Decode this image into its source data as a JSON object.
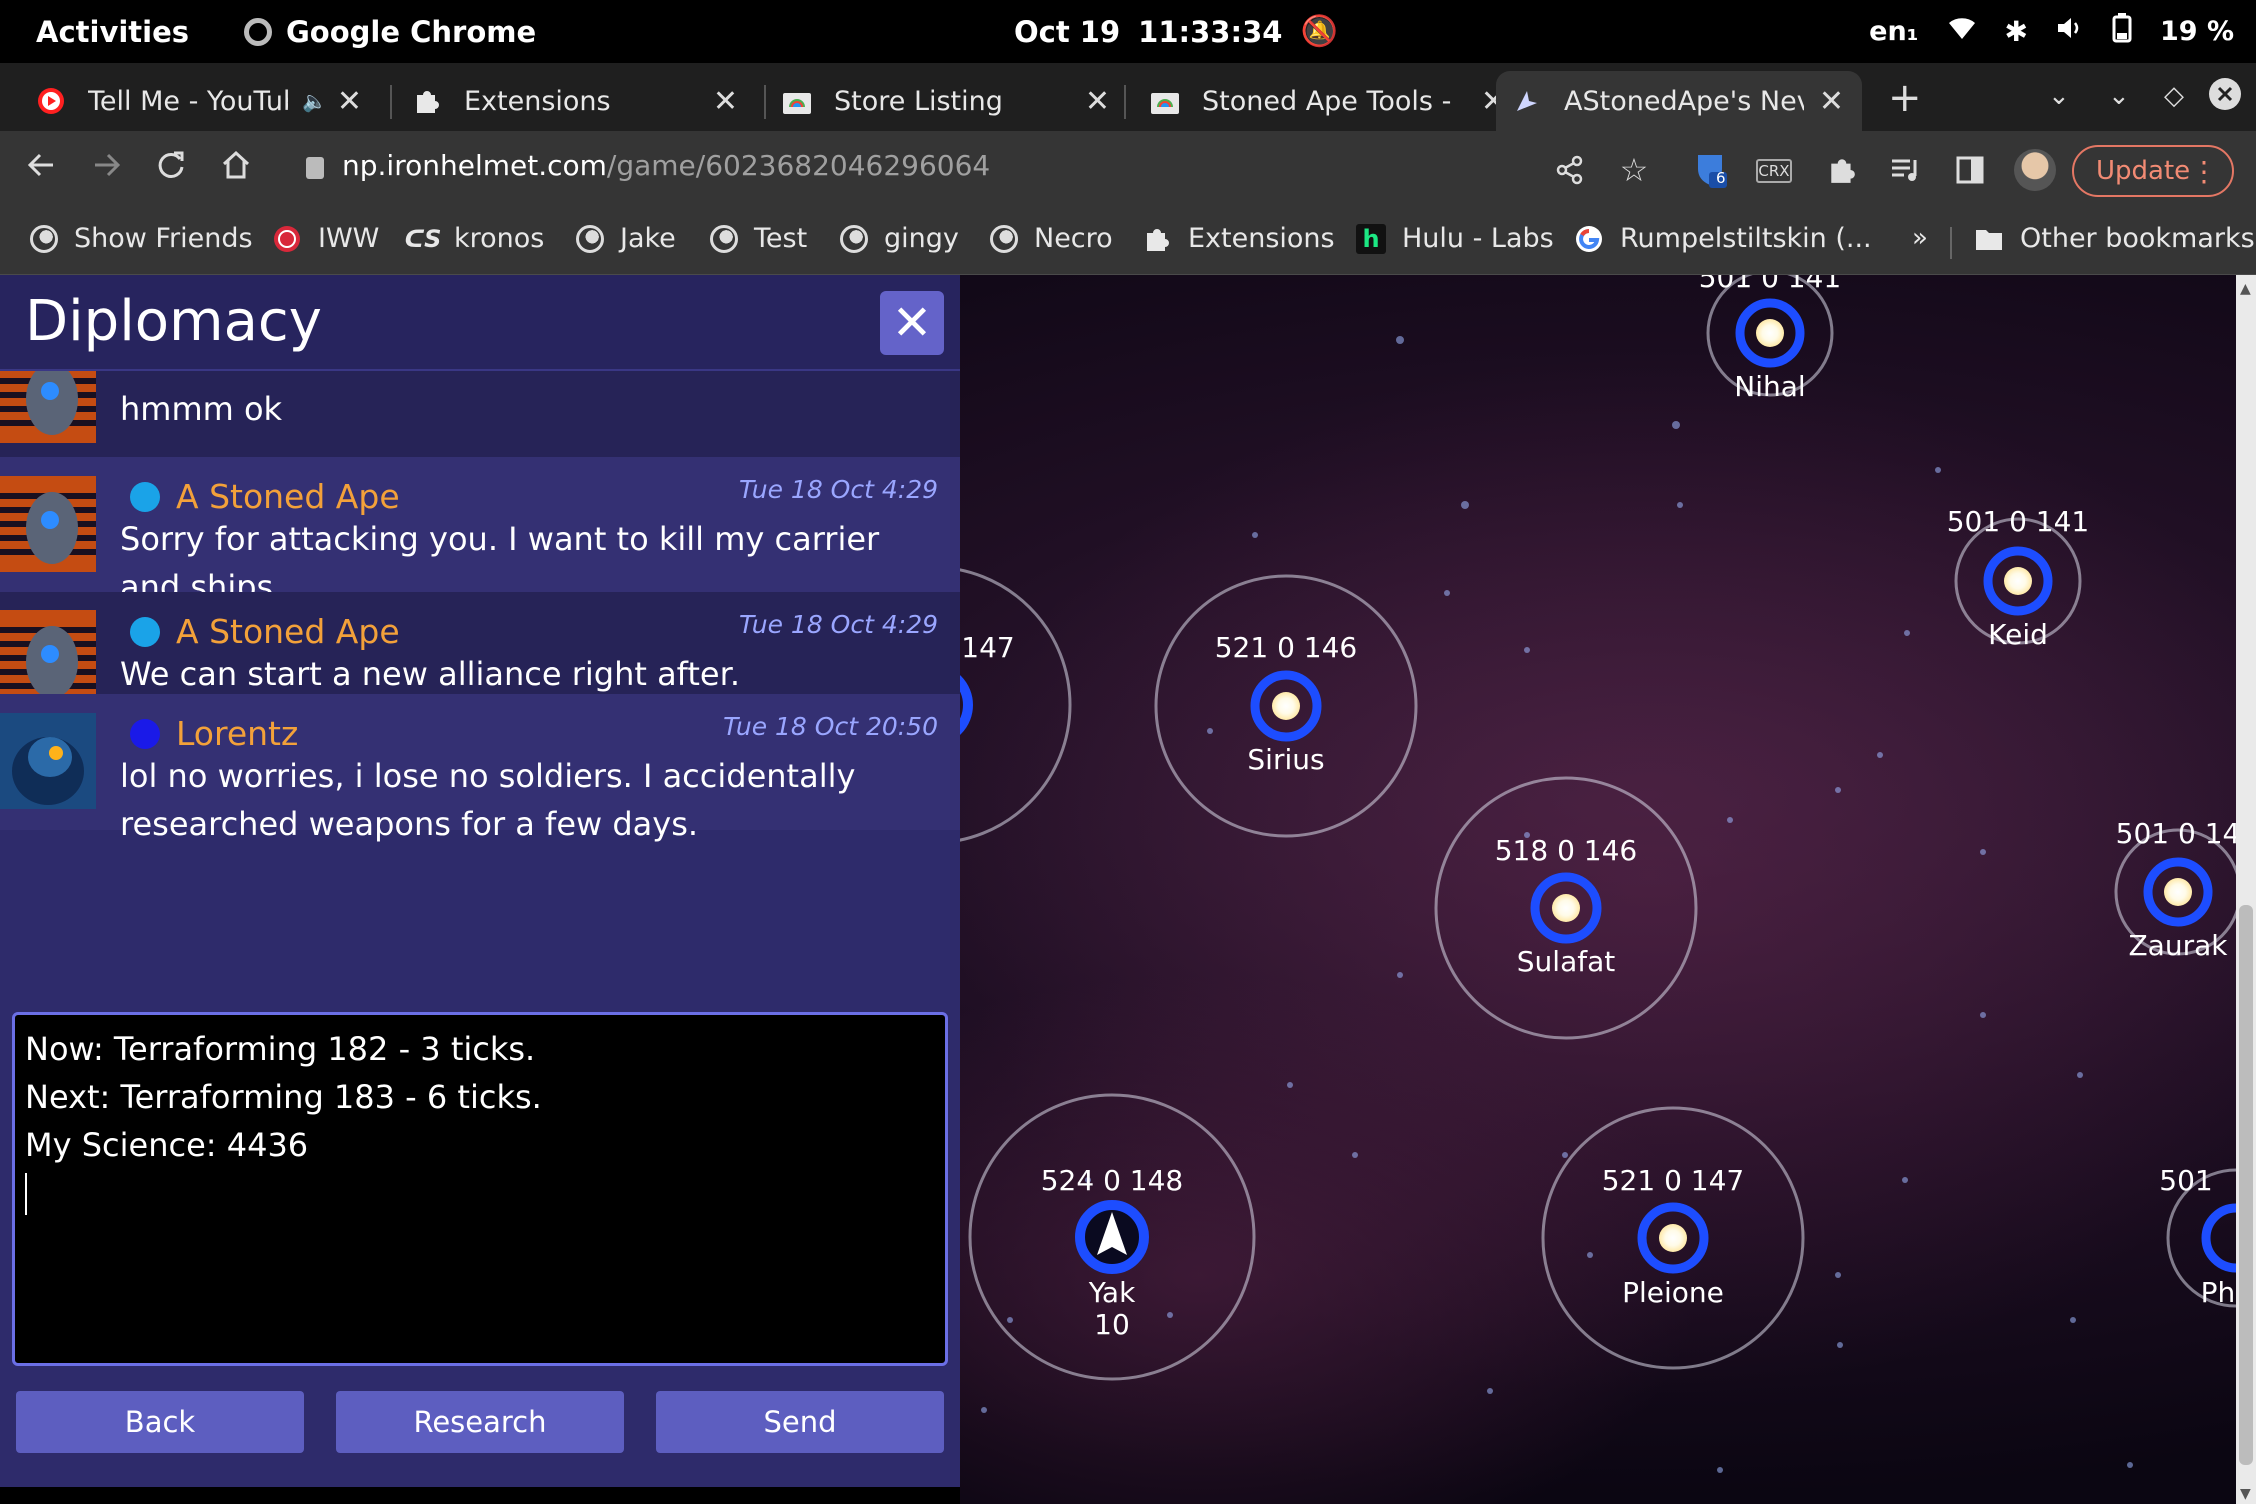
{
  "system_bar": {
    "activities": "Activities",
    "app_name": "Google Chrome",
    "date": "Oct 19",
    "time": "11:33:34",
    "keyboard": "en₁",
    "battery": "19 %"
  },
  "tabs": [
    {
      "label": "Tell Me - YouTub",
      "icon": "youtube-icon",
      "audio": true
    },
    {
      "label": "Extensions",
      "icon": "puzzle-icon"
    },
    {
      "label": "Store Listing",
      "icon": "chrome-store-icon"
    },
    {
      "label": "Stoned Ape Tools - (",
      "icon": "chrome-store-icon"
    },
    {
      "label": "AStonedApe's Neve",
      "icon": "neptune-icon",
      "active": true
    }
  ],
  "address_bar": {
    "host": "np.ironhelmet.com",
    "path": "/game/6023682046296064"
  },
  "extensions": {
    "badge_count": "6",
    "crx_label": "CRX"
  },
  "update_button": "Update",
  "bookmarks": [
    "Show Friends",
    "IWW",
    "kronos",
    "Jake",
    "Test",
    "gingy",
    "Necro",
    "Extensions",
    "Hulu - Labs",
    "Rumpelstiltskin (...",
    "Other bookmarks"
  ],
  "bookmarks_overflow": "»",
  "diplomacy": {
    "title": "Diplomacy",
    "messages": [
      {
        "sender": "",
        "time": "",
        "text": "hmmm ok",
        "dot_color": "#1aa3e8"
      },
      {
        "sender": "A Stoned Ape",
        "time": "Tue 18 Oct 4:29",
        "text": "Sorry for attacking you. I want to kill my carrier and ships.",
        "dot_color": "#1aa3e8"
      },
      {
        "sender": "A Stoned Ape",
        "time": "Tue 18 Oct 4:29",
        "text": "We can start a new alliance right after.",
        "dot_color": "#1aa3e8"
      },
      {
        "sender": "Lorentz",
        "time": "Tue 18 Oct 20:50",
        "text": "lol no worries, i lose no soldiers. I accidentally researched weapons for a few days.",
        "dot_color": "#1a1ae8"
      }
    ],
    "compose_text": "Now: Terraforming 182 - 3 ticks.\nNext: Terraforming 183 - 6 ticks.\nMy Science: 4436",
    "buttons": {
      "back": "Back",
      "research": "Research",
      "send": "Send"
    }
  },
  "stars": [
    {
      "name": "Nihal",
      "stats": "501  0  141"
    },
    {
      "name": "Keid",
      "stats": "501  0  141"
    },
    {
      "name": "",
      "stats": "147"
    },
    {
      "name": "Sirius",
      "stats": "521  0  146"
    },
    {
      "name": "Sulafat",
      "stats": "518  0  146"
    },
    {
      "name": "Zaurak",
      "stats": "501  0  14"
    },
    {
      "name": "Yak",
      "stats": "524  0  148",
      "fleet_count": "10"
    },
    {
      "name": "Pleione",
      "stats": "521  0  147"
    },
    {
      "name": "Ph",
      "stats": "501"
    }
  ],
  "colors": {
    "accent_orange": "#f3a13a",
    "panel_bg": "#2e2b6b",
    "button_bg": "#5d5ec0",
    "star_ring": "#0a3cff"
  }
}
